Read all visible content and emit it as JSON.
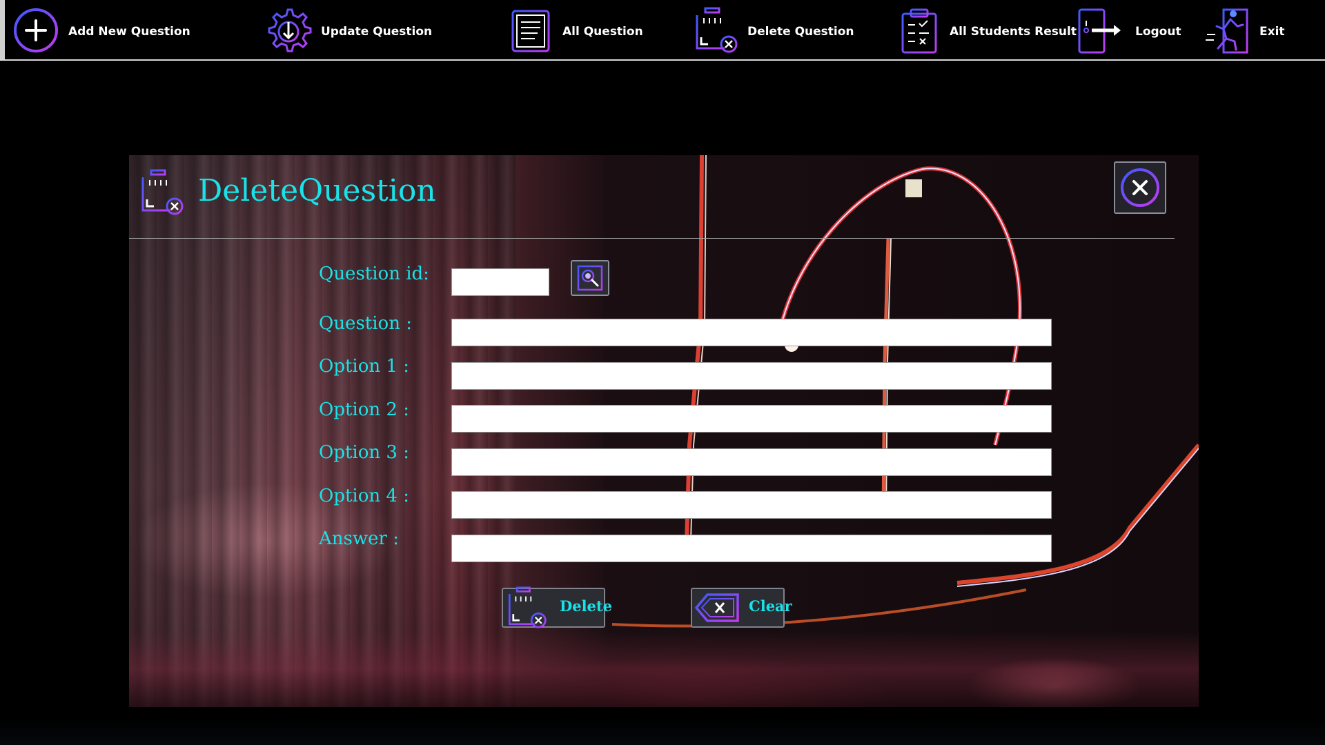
{
  "colors": {
    "accent_cyan": "#19e3e8",
    "icon_gradient_start": "#3d5afe",
    "icon_gradient_end": "#c23bf0",
    "toolbar_bg": "#000000",
    "toolbar_text": "#ffffff"
  },
  "toolbar": {
    "items": [
      {
        "label": "Add New Question",
        "icon": "plus-circle-icon"
      },
      {
        "label": "Update Question",
        "icon": "gear-download-icon"
      },
      {
        "label": "All Question",
        "icon": "document-list-icon"
      },
      {
        "label": "Delete Question",
        "icon": "trash-delete-icon"
      },
      {
        "label": "All Students Result",
        "icon": "clipboard-checklist-icon"
      },
      {
        "label": "Logout",
        "icon": "door-exit-arrow-icon"
      },
      {
        "label": "Exit",
        "icon": "running-exit-icon"
      }
    ]
  },
  "panel": {
    "title": "DeleteQuestion",
    "title_icon": "trash-delete-icon",
    "close_icon": "close-circle-icon",
    "fields": {
      "question_id": {
        "label": "Question id:",
        "value": ""
      },
      "question": {
        "label": "Question :",
        "value": ""
      },
      "option1": {
        "label": "Option 1 :",
        "value": ""
      },
      "option2": {
        "label": "Option 2 :",
        "value": ""
      },
      "option3": {
        "label": "Option 3 :",
        "value": ""
      },
      "option4": {
        "label": "Option 4 :",
        "value": ""
      },
      "answer": {
        "label": "Answer :",
        "value": ""
      }
    },
    "search_icon": "search-magnifier-icon",
    "buttons": {
      "delete": {
        "label": "Delete",
        "icon": "trash-delete-icon"
      },
      "clear": {
        "label": "Clear",
        "icon": "backspace-clear-icon"
      }
    }
  }
}
